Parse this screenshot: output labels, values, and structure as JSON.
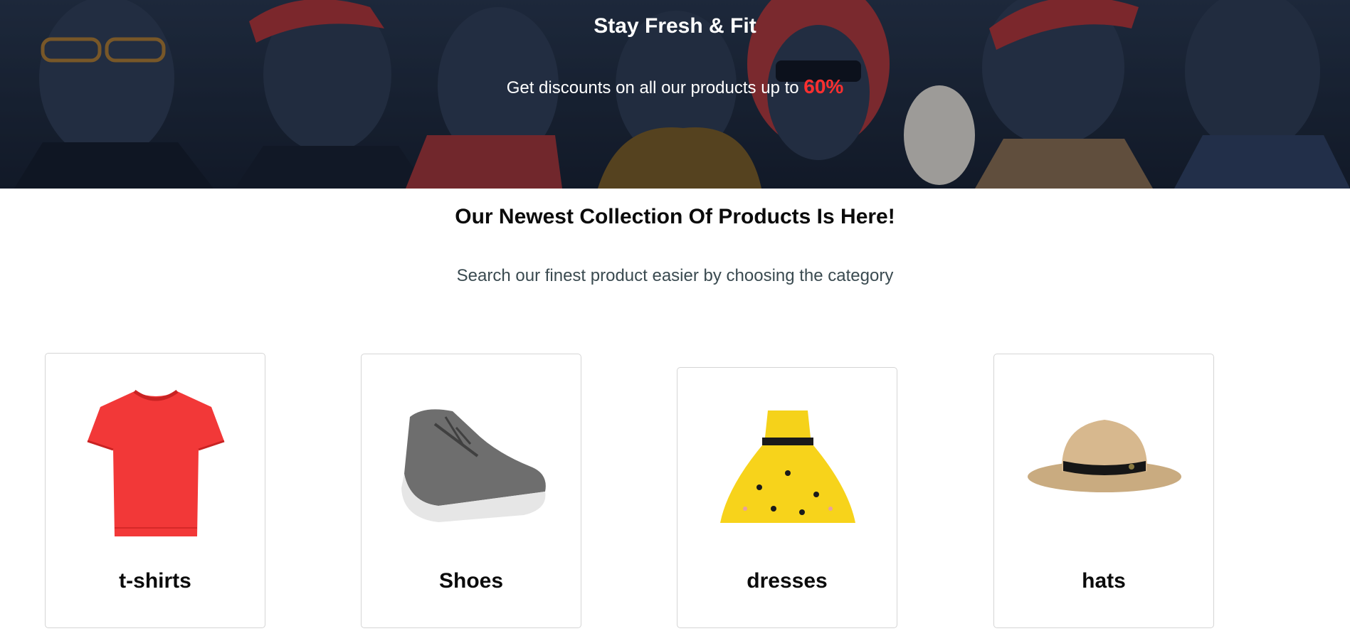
{
  "hero": {
    "title": "Stay Fresh & Fit",
    "subtitle_prefix": "Get discounts on all our products up to",
    "discount": "60%",
    "accent_color": "#ff2f2f"
  },
  "section": {
    "title": "Our Newest Collection Of Products Is Here!",
    "subtitle": "Search our finest product easier by choosing the category"
  },
  "categories": [
    {
      "label": "t-shirts",
      "icon": "t-shirt-icon"
    },
    {
      "label": "Shoes",
      "icon": "shoe-icon"
    },
    {
      "label": "dresses",
      "icon": "dress-icon"
    },
    {
      "label": "hats",
      "icon": "hat-icon"
    }
  ]
}
